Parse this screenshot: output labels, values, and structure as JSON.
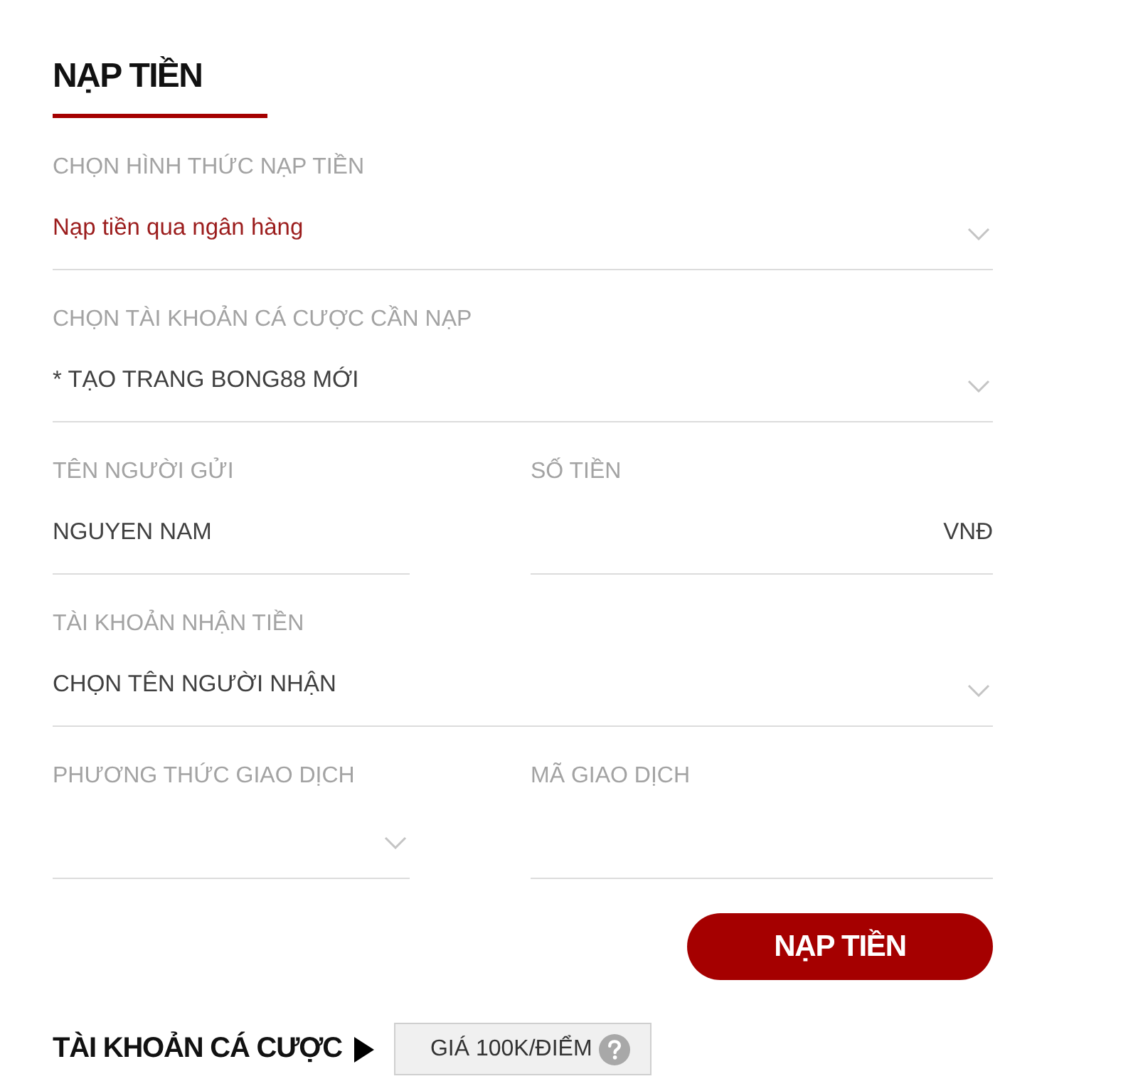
{
  "title": "NẠP TIỀN",
  "rows": [
    {
      "fields": [
        {
          "kind": "select",
          "label": "CHỌN HÌNH THỨC NẠP TIỀN",
          "value": "Nạp tiền qua ngân hàng",
          "highlight": true
        }
      ]
    },
    {
      "fields": [
        {
          "kind": "select",
          "label": "CHỌN TÀI KHOẢN CÁ CƯỢC CẦN NẠP",
          "value": "* TẠO TRANG BONG88 MỚI",
          "highlight": false
        }
      ]
    },
    {
      "fields": [
        {
          "kind": "input",
          "label": "TÊN NGƯỜI GỬI",
          "value": "NGUYEN NAM",
          "highlight": false
        },
        {
          "kind": "input",
          "label": "SỐ TIỀN",
          "suffix": "VNĐ"
        }
      ]
    },
    {
      "fields": [
        {
          "kind": "select",
          "label": "TÀI KHOẢN NHẬN TIỀN",
          "value": "CHỌN TÊN NGƯỜI NHẬN",
          "highlight": false
        }
      ]
    },
    {
      "fields": [
        {
          "kind": "select",
          "label": "PHƯƠNG THỨC GIAO DỊCH"
        },
        {
          "kind": "input",
          "label": "MÃ GIAO DỊCH"
        }
      ]
    }
  ],
  "submit_button": "NẠP TIỀN",
  "footer": {
    "title": "TÀI KHOẢN CÁ CƯỢC",
    "price_button": "GIÁ 100K/ĐIỂM"
  }
}
